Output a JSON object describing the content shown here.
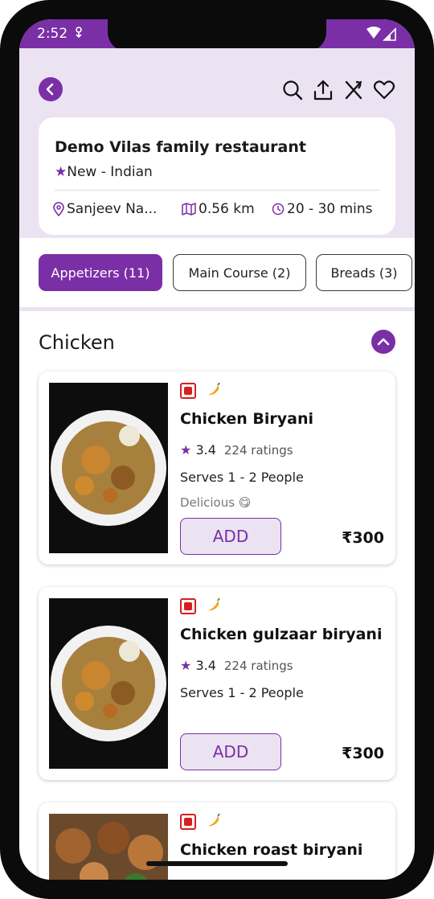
{
  "status": {
    "time": "2:52"
  },
  "restaurant": {
    "name": "Demo Vilas family restaurant",
    "badge": "New",
    "cuisine": "- Indian",
    "location": "Sanjeev Na...",
    "distance": "0.56 km",
    "delivery_time": "20 - 30 mins"
  },
  "tabs": [
    {
      "label": "Appetizers (11)",
      "active": true
    },
    {
      "label": "Main Course (2)",
      "active": false
    },
    {
      "label": "Breads (3)",
      "active": false
    }
  ],
  "section": {
    "title": "Chicken"
  },
  "items": [
    {
      "name": "Chicken Biryani",
      "rating": "3.4",
      "ratings_count": "224 ratings",
      "serves": "Serves 1 - 2 People",
      "description": "Delicious 😋",
      "add_label": "ADD",
      "price": "₹300"
    },
    {
      "name": "Chicken gulzaar biryani",
      "rating": "3.4",
      "ratings_count": "224 ratings",
      "serves": "Serves 1 - 2 People",
      "add_label": "ADD",
      "price": "₹300"
    },
    {
      "name": "Chicken roast biryani"
    }
  ],
  "colors": {
    "accent": "#7b2fa6",
    "header_bg": "#ebe3f1",
    "nonveg_mark": "#d81e1e"
  },
  "icons": [
    "back-icon",
    "search-icon",
    "share-icon",
    "cutlery-icon",
    "heart-icon",
    "location-icon",
    "map-icon",
    "clock-icon",
    "chevron-up-icon",
    "star-icon",
    "chili-icon",
    "nonveg-icon"
  ]
}
